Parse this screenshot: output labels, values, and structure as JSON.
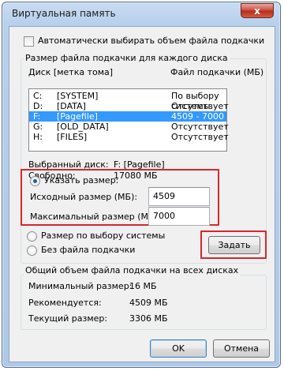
{
  "window": {
    "title": "Виртуальная память",
    "close_label": "x"
  },
  "auto_manage": {
    "label": "Автоматически выбирать объем файла подкачки",
    "checked": false
  },
  "per_disk_group": {
    "title": "Размер файла подкачки для каждого диска",
    "col_disk": "Диск [метка тома]",
    "col_size": "Файл подкачки (МБ)",
    "drives": [
      {
        "letter": "C:",
        "label": "[SYSTEM]",
        "size": "По выбору системы",
        "selected": false
      },
      {
        "letter": "D:",
        "label": "[DATA]",
        "size": "Отсутствует",
        "selected": false
      },
      {
        "letter": "F:",
        "label": "[Pagefile]",
        "size": "4509 - 7000",
        "selected": true
      },
      {
        "letter": "G:",
        "label": "[OLD_DATA]",
        "size": "Отсутствует",
        "selected": false
      },
      {
        "letter": "H:",
        "label": "[FILES]",
        "size": "Отсутствует",
        "selected": false
      }
    ],
    "selected_disk_label": "Выбранный диск:",
    "selected_disk_value": "F:  [Pagefile]",
    "free_label": "Свободно:",
    "free_value": "17080 МБ",
    "custom_size_label": "Указать размер:",
    "initial_size_label": "Исходный размер (МБ):",
    "initial_size_value": "4509",
    "max_size_label": "Максимальный размер (МБ):",
    "max_size_value": "7000",
    "system_managed_label": "Размер по выбору системы",
    "no_pagefile_label": "Без файла подкачки",
    "set_button": "Задать",
    "selected_option": "custom"
  },
  "total_group": {
    "title": "Общий объем файла подкачки на всех дисках",
    "min_label": "Минимальный размер:",
    "min_value": "16 МБ",
    "recommended_label": "Рекомендуется:",
    "recommended_value": "4509 МБ",
    "current_label": "Текущий размер:",
    "current_value": "3306 МБ"
  },
  "buttons": {
    "ok": "OK",
    "cancel": "Отмена"
  },
  "colors": {
    "selection": "#3399ff",
    "highlight_box": "#d6262d"
  }
}
